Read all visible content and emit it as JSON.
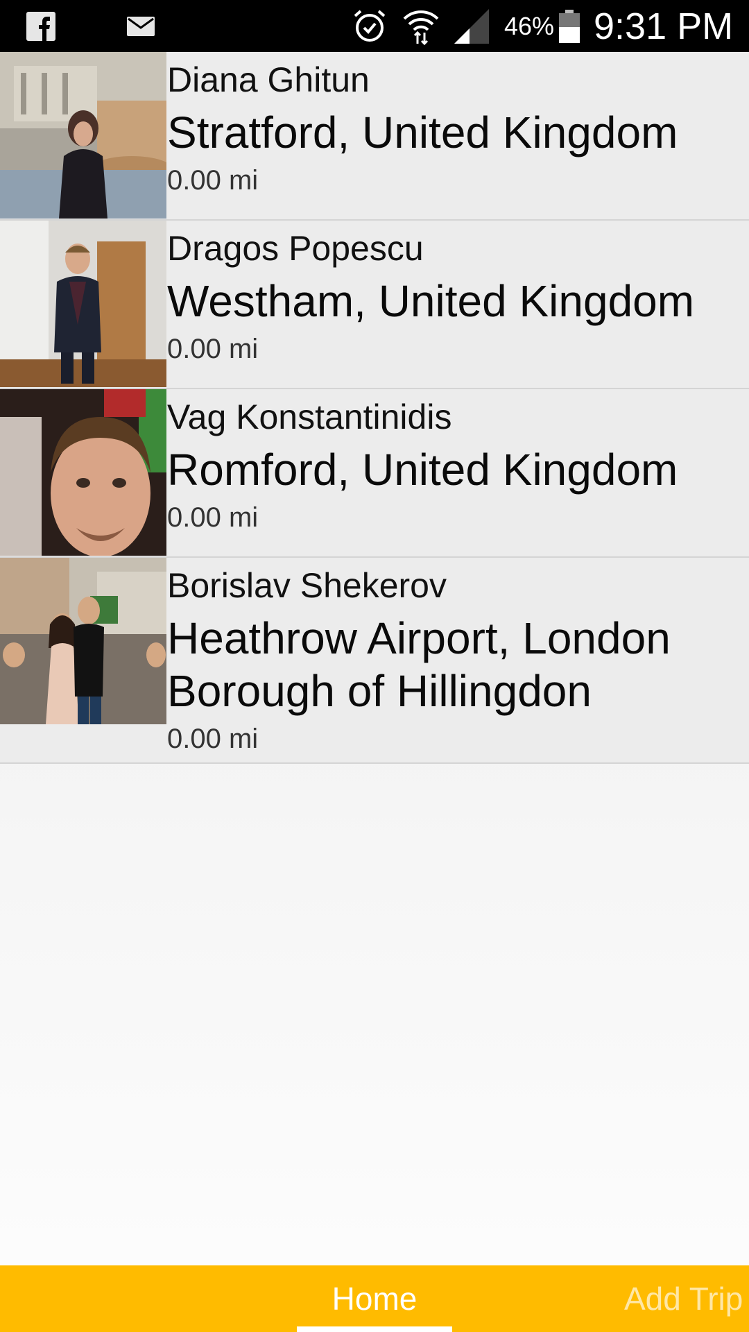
{
  "status_bar": {
    "icons": [
      "facebook-icon",
      "mail-icon",
      "alarm-icon",
      "wifi-icon",
      "signal-icon",
      "battery-icon"
    ],
    "battery_text": "46%",
    "time": "9:31 PM"
  },
  "contacts": [
    {
      "name": "Diana Ghitun",
      "location": "Stratford, United Kingdom",
      "distance": "0.00 mi"
    },
    {
      "name": "Dragos Popescu",
      "location": "Westham, United Kingdom",
      "distance": "0.00 mi"
    },
    {
      "name": "Vag Konstantinidis",
      "location": "Romford, United Kingdom",
      "distance": "0.00 mi"
    },
    {
      "name": "Borislav Shekerov",
      "location": "Heathrow Airport, London Borough of Hillingdon",
      "distance": "0.00 mi"
    }
  ],
  "tabs": [
    {
      "label": "Home",
      "selected": true
    },
    {
      "label": "Add Trip",
      "selected": false
    }
  ],
  "colors": {
    "accent": "#ffbb00",
    "status_bar": "#000000"
  }
}
